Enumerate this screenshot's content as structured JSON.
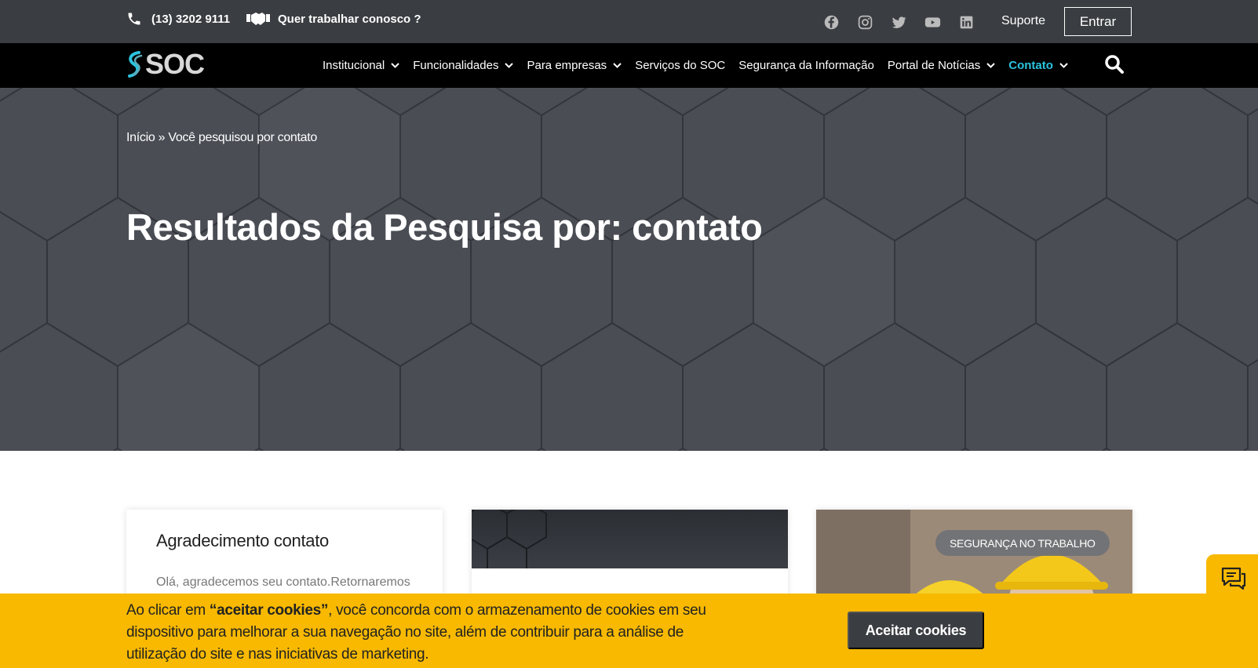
{
  "topbar": {
    "phone": "(13) 3202 9111",
    "jobs": "Quer trabalhar conosco ?",
    "socials": [
      "facebook-icon",
      "instagram-icon",
      "twitter-icon",
      "youtube-icon",
      "linkedin-icon"
    ],
    "suporte": "Suporte",
    "entrar": "Entrar"
  },
  "nav": {
    "logo": "SOC",
    "items": [
      {
        "label": "Institucional",
        "dropdown": true
      },
      {
        "label": "Funcionalidades",
        "dropdown": true
      },
      {
        "label": "Para empresas",
        "dropdown": true
      },
      {
        "label": "Serviços do SOC",
        "dropdown": false
      },
      {
        "label": "Segurança da Informação",
        "dropdown": false
      },
      {
        "label": "Portal de Notícias",
        "dropdown": true
      },
      {
        "label": "Contato",
        "dropdown": true,
        "active": true
      }
    ]
  },
  "hero": {
    "breadcrumb_home": "Início",
    "breadcrumb_sep": " » ",
    "breadcrumb_current": "Você pesquisou por contato",
    "title": "Resultados da Pesquisa por: contato"
  },
  "cards": [
    {
      "title": "Agradecimento contato",
      "excerpt": "Olá, agradecemos seu contato.Retornaremos"
    },
    {},
    {
      "badge": "SEGURANÇA NO TRABALHO"
    }
  ],
  "cookie": {
    "text_before": "Ao clicar em ",
    "text_bold": "“aceitar cookies”",
    "text_after": ", você concorda com o armazenamento de cookies em seu dispositivo para melhorar a sua navegação no site, além de contribuir para a análise de utilização do site e nas iniciativas de marketing.",
    "button": "Aceitar cookies"
  },
  "colors": {
    "topbar": "#3a3d41",
    "navbar": "#000000",
    "accent": "#2bc3de",
    "cookie_bg": "#f8b900"
  }
}
